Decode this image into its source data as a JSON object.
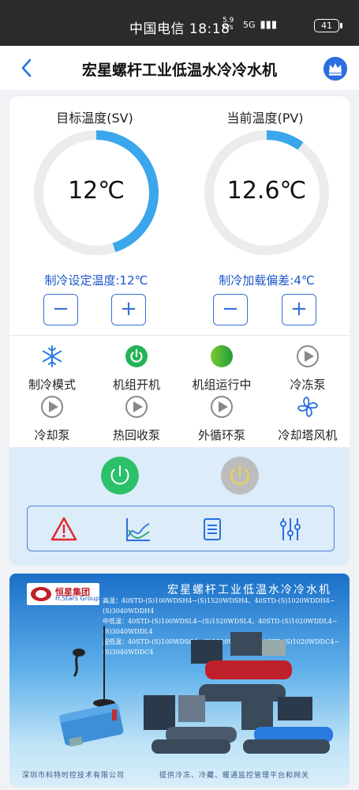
{
  "status_bar": {
    "carrier_time": "中国电信 18:18",
    "network_speed": "5.9 K/s",
    "signal": "5G",
    "battery": "41"
  },
  "header": {
    "title": "宏星螺杆工业低温水冷冷水机",
    "back_icon": "chevron-left-icon",
    "crown_icon": "crown-icon"
  },
  "gauges": {
    "target": {
      "label": "目标温度(SV)",
      "value": "12℃",
      "fill": 0.45,
      "color": "#3aa6ec"
    },
    "current": {
      "label": "当前温度(PV)",
      "value": "12.6℃",
      "fill": 0.1,
      "color": "#3aa6ec"
    }
  },
  "setpoints": {
    "cooling_setpoint": "制冷设定温度:12℃",
    "cooling_deviation": "制冷加载偏差:4℃",
    "minus": "−",
    "plus": "+"
  },
  "status_items": [
    {
      "label": "制冷模式",
      "icon": "snowflake-icon"
    },
    {
      "label": "机组开机",
      "icon": "power-on-icon"
    },
    {
      "label": "机组运行中",
      "icon": "running-indicator-icon"
    },
    {
      "label": "冷冻泵",
      "icon": "play-gray-icon"
    },
    {
      "label": "冷却泵",
      "icon": "play-gray-icon"
    },
    {
      "label": "热回收泵",
      "icon": "play-gray-icon"
    },
    {
      "label": "外循环泵",
      "icon": "play-gray-icon"
    },
    {
      "label": "冷却塔风机",
      "icon": "fan-icon"
    }
  ],
  "controls": {
    "power_on_color": "#2cc06a",
    "power_off_color": "#bdbdbd",
    "toolbar_icons": [
      "alarm-icon",
      "trend-chart-icon",
      "list-icon",
      "settings-sliders-icon"
    ]
  },
  "banner": {
    "logo_name": "恒星集团",
    "logo_sub": "H.Stars Group",
    "title": "宏星螺杆工业低温水冷冷水机",
    "lines": [
      "高温：40STD-(S)100WDSH4~(S)1520WDSH4、40STD-(S)1020WDDH4~(S)3040WDDH4",
      "中低温：40STD-(S)100WDSL4~(S)1520WDSL4、40STD-(S)1020WDDL4~(S)3040WDDL4",
      "超低温：40STD-(S)100WDSC4~(S)1520WDSC4、40STD-(S)1020WDDC4~(S)3040WDDC4"
    ],
    "footer_left": "深圳市科特时控技术有限公司",
    "footer_right": "提供冷冻、冷藏、暖通监控管理平台和网关"
  }
}
